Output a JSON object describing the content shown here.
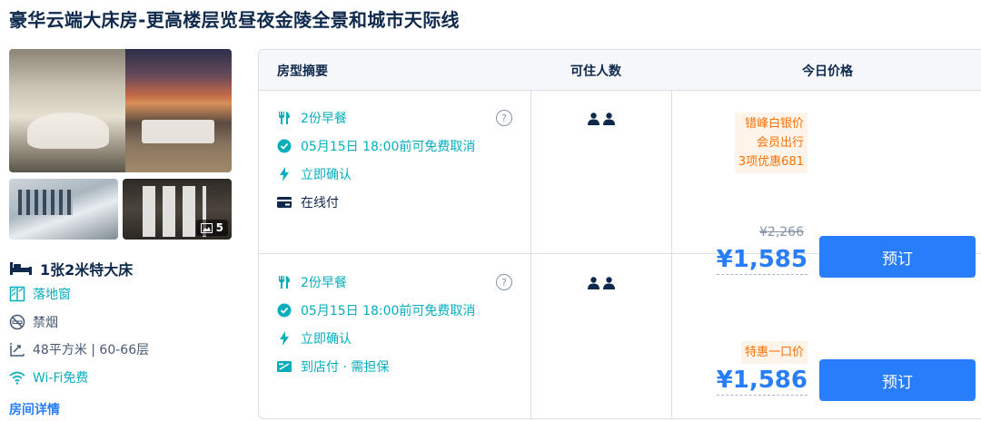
{
  "room": {
    "title": "豪华云端大床房-更高楼层览昼夜金陵全景和城市天际线",
    "photo_count": "5",
    "bed": "1张2米特大床",
    "facilities": {
      "window": "落地窗",
      "smoking": "禁烟",
      "area": "48平方米 | 60-66层",
      "wifi": "Wi-Fi免费"
    },
    "detail_link": "房间详情"
  },
  "table": {
    "headers": {
      "summary": "房型摘要",
      "occupancy": "可住人数",
      "price": "今日价格"
    },
    "rows": [
      {
        "breakfast": "2份早餐",
        "cancel": "05月15日 18:00前可免费取消",
        "confirm": "立即确认",
        "payment": "在线付",
        "guests": 2,
        "promo_lines": [
          "错峰白银价",
          "会员出行",
          "3项优惠681"
        ],
        "original_price": "¥2,266",
        "price": "¥1,585",
        "book_label": "预订"
      },
      {
        "breakfast": "2份早餐",
        "cancel": "05月15日 18:00前可免费取消",
        "confirm": "立即确认",
        "payment": "到店付 · 需担保",
        "guests": 2,
        "promo_lines": [
          "特惠一口价"
        ],
        "price": "¥1,586",
        "book_label": "预订"
      }
    ]
  },
  "colors": {
    "accent_blue": "#287dfa",
    "teal": "#06aebd",
    "orange": "#ff6f00",
    "text_dark": "#0f294d"
  },
  "icons": [
    "cutlery-icon",
    "check-circle-icon",
    "lightning-icon",
    "card-icon",
    "cash-icon",
    "person-icon",
    "bed-icon",
    "window-icon",
    "no-smoking-icon",
    "area-icon",
    "wifi-icon",
    "image-icon",
    "help-icon"
  ]
}
